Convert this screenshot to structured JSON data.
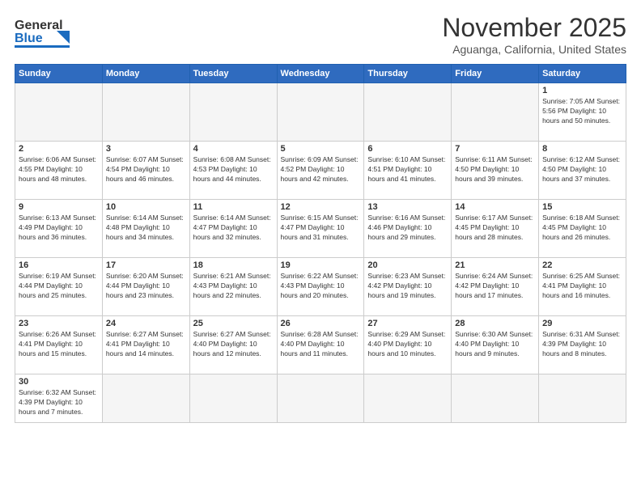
{
  "header": {
    "logo_general": "General",
    "logo_blue": "Blue",
    "month_title": "November 2025",
    "location": "Aguanga, California, United States"
  },
  "weekdays": [
    "Sunday",
    "Monday",
    "Tuesday",
    "Wednesday",
    "Thursday",
    "Friday",
    "Saturday"
  ],
  "weeks": [
    [
      {
        "day": "",
        "info": ""
      },
      {
        "day": "",
        "info": ""
      },
      {
        "day": "",
        "info": ""
      },
      {
        "day": "",
        "info": ""
      },
      {
        "day": "",
        "info": ""
      },
      {
        "day": "",
        "info": ""
      },
      {
        "day": "1",
        "info": "Sunrise: 7:05 AM\nSunset: 5:56 PM\nDaylight: 10 hours and 50 minutes."
      }
    ],
    [
      {
        "day": "2",
        "info": "Sunrise: 6:06 AM\nSunset: 4:55 PM\nDaylight: 10 hours and 48 minutes."
      },
      {
        "day": "3",
        "info": "Sunrise: 6:07 AM\nSunset: 4:54 PM\nDaylight: 10 hours and 46 minutes."
      },
      {
        "day": "4",
        "info": "Sunrise: 6:08 AM\nSunset: 4:53 PM\nDaylight: 10 hours and 44 minutes."
      },
      {
        "day": "5",
        "info": "Sunrise: 6:09 AM\nSunset: 4:52 PM\nDaylight: 10 hours and 42 minutes."
      },
      {
        "day": "6",
        "info": "Sunrise: 6:10 AM\nSunset: 4:51 PM\nDaylight: 10 hours and 41 minutes."
      },
      {
        "day": "7",
        "info": "Sunrise: 6:11 AM\nSunset: 4:50 PM\nDaylight: 10 hours and 39 minutes."
      },
      {
        "day": "8",
        "info": "Sunrise: 6:12 AM\nSunset: 4:50 PM\nDaylight: 10 hours and 37 minutes."
      }
    ],
    [
      {
        "day": "9",
        "info": "Sunrise: 6:13 AM\nSunset: 4:49 PM\nDaylight: 10 hours and 36 minutes."
      },
      {
        "day": "10",
        "info": "Sunrise: 6:14 AM\nSunset: 4:48 PM\nDaylight: 10 hours and 34 minutes."
      },
      {
        "day": "11",
        "info": "Sunrise: 6:14 AM\nSunset: 4:47 PM\nDaylight: 10 hours and 32 minutes."
      },
      {
        "day": "12",
        "info": "Sunrise: 6:15 AM\nSunset: 4:47 PM\nDaylight: 10 hours and 31 minutes."
      },
      {
        "day": "13",
        "info": "Sunrise: 6:16 AM\nSunset: 4:46 PM\nDaylight: 10 hours and 29 minutes."
      },
      {
        "day": "14",
        "info": "Sunrise: 6:17 AM\nSunset: 4:45 PM\nDaylight: 10 hours and 28 minutes."
      },
      {
        "day": "15",
        "info": "Sunrise: 6:18 AM\nSunset: 4:45 PM\nDaylight: 10 hours and 26 minutes."
      }
    ],
    [
      {
        "day": "16",
        "info": "Sunrise: 6:19 AM\nSunset: 4:44 PM\nDaylight: 10 hours and 25 minutes."
      },
      {
        "day": "17",
        "info": "Sunrise: 6:20 AM\nSunset: 4:44 PM\nDaylight: 10 hours and 23 minutes."
      },
      {
        "day": "18",
        "info": "Sunrise: 6:21 AM\nSunset: 4:43 PM\nDaylight: 10 hours and 22 minutes."
      },
      {
        "day": "19",
        "info": "Sunrise: 6:22 AM\nSunset: 4:43 PM\nDaylight: 10 hours and 20 minutes."
      },
      {
        "day": "20",
        "info": "Sunrise: 6:23 AM\nSunset: 4:42 PM\nDaylight: 10 hours and 19 minutes."
      },
      {
        "day": "21",
        "info": "Sunrise: 6:24 AM\nSunset: 4:42 PM\nDaylight: 10 hours and 17 minutes."
      },
      {
        "day": "22",
        "info": "Sunrise: 6:25 AM\nSunset: 4:41 PM\nDaylight: 10 hours and 16 minutes."
      }
    ],
    [
      {
        "day": "23",
        "info": "Sunrise: 6:26 AM\nSunset: 4:41 PM\nDaylight: 10 hours and 15 minutes."
      },
      {
        "day": "24",
        "info": "Sunrise: 6:27 AM\nSunset: 4:41 PM\nDaylight: 10 hours and 14 minutes."
      },
      {
        "day": "25",
        "info": "Sunrise: 6:27 AM\nSunset: 4:40 PM\nDaylight: 10 hours and 12 minutes."
      },
      {
        "day": "26",
        "info": "Sunrise: 6:28 AM\nSunset: 4:40 PM\nDaylight: 10 hours and 11 minutes."
      },
      {
        "day": "27",
        "info": "Sunrise: 6:29 AM\nSunset: 4:40 PM\nDaylight: 10 hours and 10 minutes."
      },
      {
        "day": "28",
        "info": "Sunrise: 6:30 AM\nSunset: 4:40 PM\nDaylight: 10 hours and 9 minutes."
      },
      {
        "day": "29",
        "info": "Sunrise: 6:31 AM\nSunset: 4:39 PM\nDaylight: 10 hours and 8 minutes."
      }
    ],
    [
      {
        "day": "30",
        "info": "Sunrise: 6:32 AM\nSunset: 4:39 PM\nDaylight: 10 hours and 7 minutes."
      },
      {
        "day": "",
        "info": ""
      },
      {
        "day": "",
        "info": ""
      },
      {
        "day": "",
        "info": ""
      },
      {
        "day": "",
        "info": ""
      },
      {
        "day": "",
        "info": ""
      },
      {
        "day": "",
        "info": ""
      }
    ]
  ]
}
